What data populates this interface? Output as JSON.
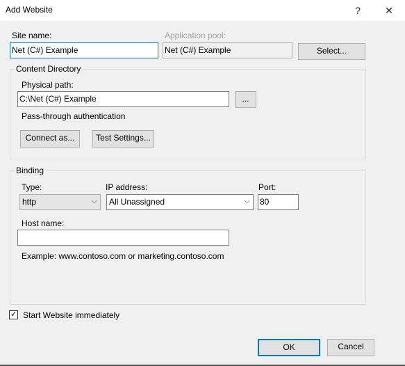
{
  "window": {
    "title": "Add Website",
    "help_icon": "?",
    "close_icon": "✕"
  },
  "site": {
    "label": "Site name:",
    "value": "Net (C#) Example"
  },
  "app_pool": {
    "label": "Application pool:",
    "value": "Net (C#) Example",
    "select_label": "Select..."
  },
  "content": {
    "group_label": "Content Directory",
    "path_label": "Physical path:",
    "path_value": "C:\\Net (C#) Example",
    "browse_label": "...",
    "auth_label": "Pass-through authentication",
    "connect_label": "Connect as...",
    "test_label": "Test Settings..."
  },
  "binding": {
    "group_label": "Binding",
    "type_label": "Type:",
    "type_value": "http",
    "ip_label": "IP address:",
    "ip_value": "All Unassigned",
    "port_label": "Port:",
    "port_value": "80",
    "host_label": "Host name:",
    "host_value": "",
    "example": "Example: www.contoso.com or marketing.contoso.com"
  },
  "start": {
    "label": "Start Website immediately",
    "checked": true,
    "check_glyph": "✓"
  },
  "footer": {
    "ok": "OK",
    "cancel": "Cancel"
  },
  "colors": {
    "focus": "#0078d7"
  }
}
